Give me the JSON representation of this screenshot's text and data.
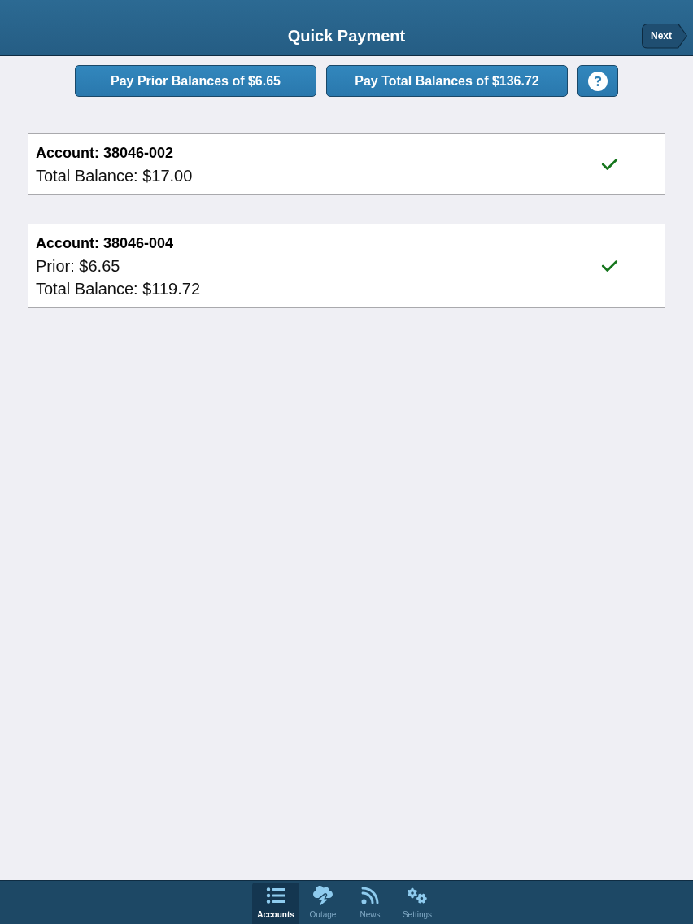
{
  "header": {
    "title": "Quick Payment",
    "next_button": "Next"
  },
  "actions": [
    {
      "kind": "text",
      "label": "Pay Prior Balances of $6.65"
    },
    {
      "kind": "text",
      "label": "Pay Total Balances of $136.72"
    },
    {
      "kind": "help"
    }
  ],
  "accounts": [
    {
      "title": "Account: 38046-002",
      "lines": [
        "Total Balance: $17.00"
      ],
      "checked": true
    },
    {
      "title": "Account: 38046-004",
      "lines": [
        "Prior: $6.65",
        "Total Balance: $119.72"
      ],
      "checked": true
    }
  ],
  "tab_bar": [
    {
      "label": "Accounts",
      "selected": true
    },
    {
      "label": "Outage",
      "selected": false
    },
    {
      "label": "News",
      "selected": false
    },
    {
      "label": "Settings",
      "selected": false
    }
  ]
}
